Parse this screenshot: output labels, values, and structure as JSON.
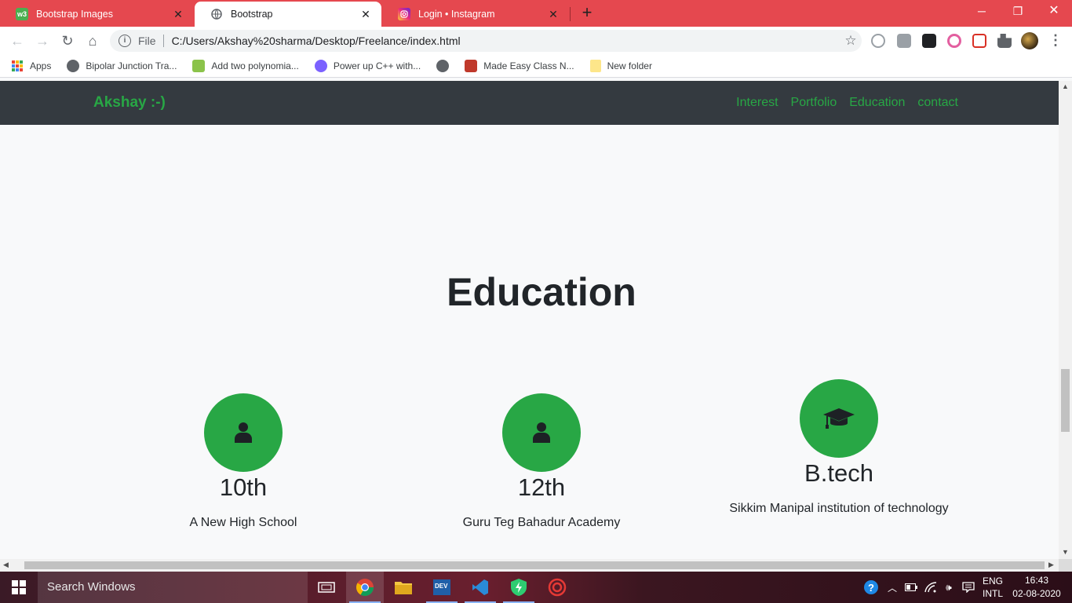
{
  "browser": {
    "tabs": [
      {
        "title": "Bootstrap Images",
        "favicon": "w3-icon",
        "active": false
      },
      {
        "title": "Bootstrap",
        "favicon": "globe-icon",
        "active": true
      },
      {
        "title": "Login • Instagram",
        "favicon": "instagram-icon",
        "active": false
      }
    ],
    "address": {
      "scheme_label": "File",
      "url": "C:/Users/Akshay%20sharma/Desktop/Freelance/index.html"
    },
    "bookmarks": [
      {
        "label": "Apps"
      },
      {
        "label": "Bipolar Junction Tra..."
      },
      {
        "label": "Add two polynomia..."
      },
      {
        "label": "Power up C++ with..."
      },
      {
        "label": ""
      },
      {
        "label": "Made Easy Class N..."
      },
      {
        "label": "New folder"
      }
    ],
    "accent_color": "#e5484f"
  },
  "page": {
    "brand": "Akshay :-)",
    "nav": [
      "Interest",
      "Portfolio",
      "Education",
      "contact"
    ],
    "section_title": "Education",
    "education": [
      {
        "icon": "user-icon",
        "level": "10th",
        "school": "A New High School"
      },
      {
        "icon": "user-icon",
        "level": "12th",
        "school": "Guru Teg Bahadur Academy"
      },
      {
        "icon": "graduation-cap-icon",
        "level": "B.tech",
        "school": "Sikkim Manipal institution of technology"
      }
    ],
    "colors": {
      "navbar": "#343a40",
      "accent": "#28a745",
      "background": "#f8f9fa"
    }
  },
  "taskbar": {
    "search_placeholder": "Search Windows",
    "language": "ENG",
    "layout": "INTL",
    "time": "16:43",
    "date": "02-08-2020"
  }
}
